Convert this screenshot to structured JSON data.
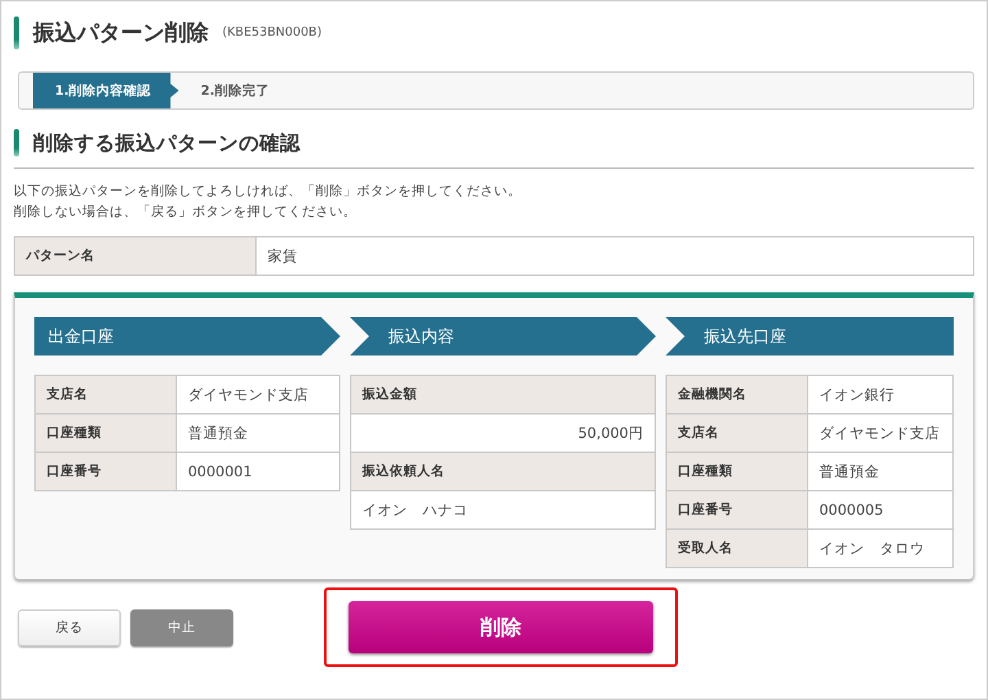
{
  "page_title": "振込パターン削除",
  "screen_code": "(KBE53BN000B)",
  "steps": [
    {
      "label": "1.削除内容確認",
      "selected": true
    },
    {
      "label": "2.削除完了",
      "selected": false
    }
  ],
  "section_title": "削除する振込パターンの確認",
  "instructions": [
    "以下の振込パターンを削除してよろしければ、「削除」ボタンを押してください。",
    "削除しない場合は、「戻る」ボタンを押してください。"
  ],
  "pattern_name": {
    "label": "パターン名",
    "value": "家賃"
  },
  "columns": [
    {
      "title": "出金口座",
      "kind": "side",
      "rows": [
        {
          "label": "支店名",
          "value": "ダイヤモンド支店"
        },
        {
          "label": "口座種類",
          "value": "普通預金"
        },
        {
          "label": "口座番号",
          "value": "0000001"
        }
      ]
    },
    {
      "title": "振込内容",
      "kind": "stacked",
      "rows": [
        {
          "label": "振込金額",
          "value": "50,000円",
          "kind": "amount"
        },
        {
          "label": "振込依頼人名",
          "value": "イオン　ハナコ",
          "kind": "name"
        }
      ]
    },
    {
      "title": "振込先口座",
      "kind": "side",
      "rows": [
        {
          "label": "金融機関名",
          "value": "イオン銀行"
        },
        {
          "label": "支店名",
          "value": "ダイヤモンド支店"
        },
        {
          "label": "口座種類",
          "value": "普通預金"
        },
        {
          "label": "口座番号",
          "value": "0000005"
        },
        {
          "label": "受取人名",
          "value": "イオン　タロウ"
        }
      ]
    }
  ],
  "buttons": {
    "back": "戻る",
    "cancel": "中止",
    "delete": "削除"
  }
}
